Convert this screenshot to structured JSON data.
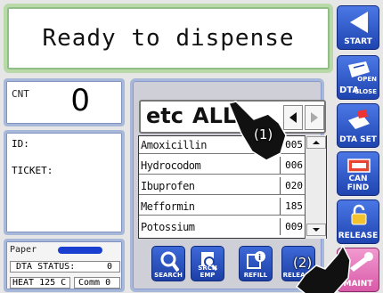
{
  "message": "Ready to dispense",
  "counter": {
    "label": "CNT",
    "value": "0"
  },
  "id_panel": {
    "id_label": "ID:",
    "ticket_label": "TICKET:"
  },
  "status": {
    "paper_label": "Paper",
    "dta_status_label": "DTA STATUS:",
    "dta_status_value": "0",
    "heat_label": "HEAT 125  C",
    "comm_label": "Comm 0"
  },
  "tabs": {
    "etc": "etc",
    "all": "ALL"
  },
  "drugs": [
    {
      "name": "Amoxicillin",
      "code": "005"
    },
    {
      "name": "Hydrocodom",
      "code": "006"
    },
    {
      "name": "Ibuprofen",
      "code": "020"
    },
    {
      "name": "Mefformin",
      "code": "185"
    },
    {
      "name": "Potossium",
      "code": "009"
    }
  ],
  "center_buttons": [
    "SEARCH",
    "SRCH EMP",
    "REFILL",
    "RELEASE"
  ],
  "right_buttons": {
    "start": "START",
    "dta_open_top": "OPEN",
    "dta_open_bottom": "CLOSE",
    "dta_open_main": "DTA",
    "dta_set": "DTA SET",
    "can_find": "CAN FIND",
    "release": "RELEASE",
    "maint": "MAINT"
  },
  "callouts": {
    "one": "(1)",
    "two": "(2)"
  },
  "colors": {
    "button_blue": "#2a52c8",
    "maint_pink": "#e176b9",
    "message_border": "#b9d9a8"
  }
}
